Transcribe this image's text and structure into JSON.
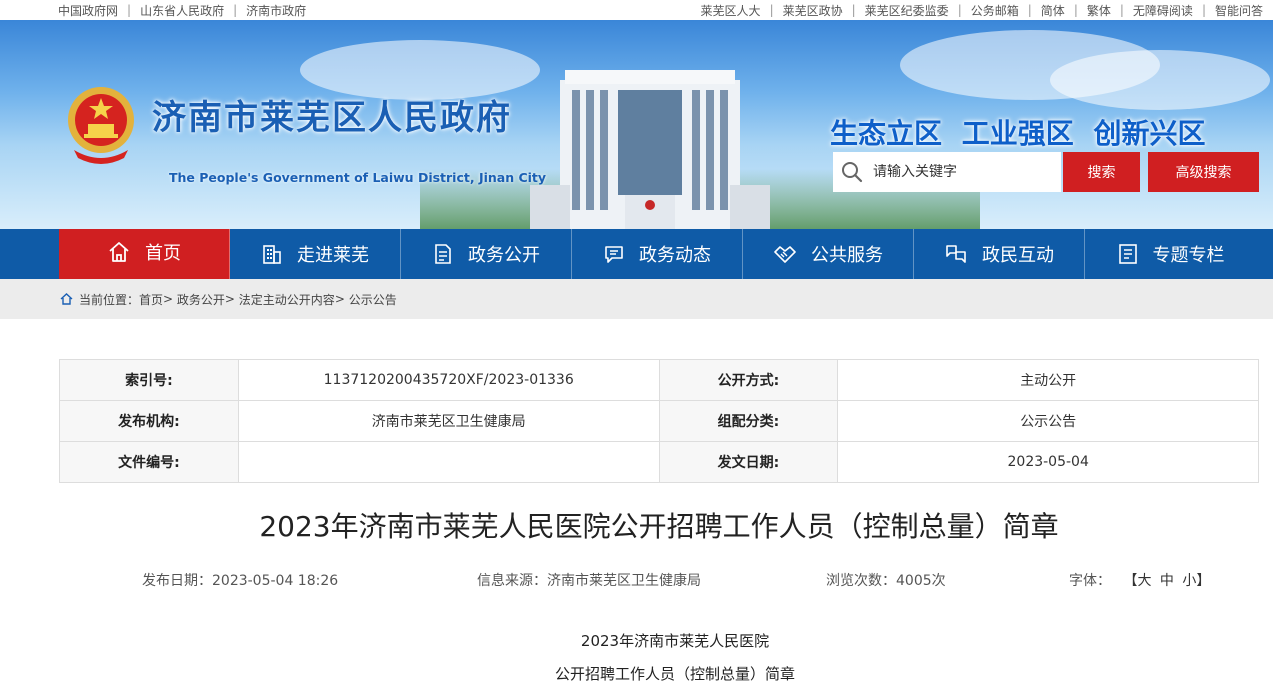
{
  "topbar": {
    "left_links": [
      "中国政府网",
      "山东省人民政府",
      "济南市政府"
    ],
    "right_links": [
      "莱芜区人大",
      "莱芜区政协",
      "莱芜区纪委监委",
      "公务邮箱",
      "简体",
      "繁体",
      "无障碍阅读",
      "智能问答"
    ]
  },
  "header": {
    "title": "济南市莱芜区人民政府",
    "subtitle": "The People's Government of Laiwu District, Jinan City",
    "slogan": "生态立区 工业强区 创新兴区",
    "search_placeholder": "请输入关键字",
    "search_button": "搜索",
    "advanced_search_button": "高级搜索"
  },
  "nav": {
    "items": [
      {
        "label": "首页",
        "icon": "home-icon"
      },
      {
        "label": "走进莱芜",
        "icon": "building-icon"
      },
      {
        "label": "政务公开",
        "icon": "document-icon"
      },
      {
        "label": "政务动态",
        "icon": "message-icon"
      },
      {
        "label": "公共服务",
        "icon": "handshake-icon"
      },
      {
        "label": "政民互动",
        "icon": "interaction-icon"
      },
      {
        "label": "专题专栏",
        "icon": "list-icon"
      }
    ]
  },
  "breadcrumb": {
    "prefix": "当前位置：",
    "items": [
      "首页",
      "政务公开",
      "法定主动公开内容",
      "公示公告"
    ]
  },
  "meta": {
    "rows": [
      {
        "l1": "索引号:",
        "v1": "11371202004357​20XF/2023-01336",
        "l2": "公开方式:",
        "v2": "主动公开"
      },
      {
        "l1": "发布机构:",
        "v1": "济南市莱芜区卫生健康局",
        "l2": "组配分类:",
        "v2": "公示公告"
      },
      {
        "l1": "文件编号:",
        "v1": "",
        "l2": "发文日期:",
        "v2": "2023-05-04"
      }
    ]
  },
  "article": {
    "title": "2023年济南市莱芜人民医院公开招聘工作人员（控制总量）简章",
    "publish_date": "发布日期：2023-05-04 18:26",
    "source": "信息来源：济南市莱芜区卫生健康局",
    "views": "浏览次数：4005次",
    "font_label": "字体：",
    "font_large": "大",
    "font_medium": "中",
    "font_small": "小",
    "body_line1": "2023年济南市莱芜人民医院",
    "body_line2": "公开招聘工作人员（控制总量）简章"
  }
}
